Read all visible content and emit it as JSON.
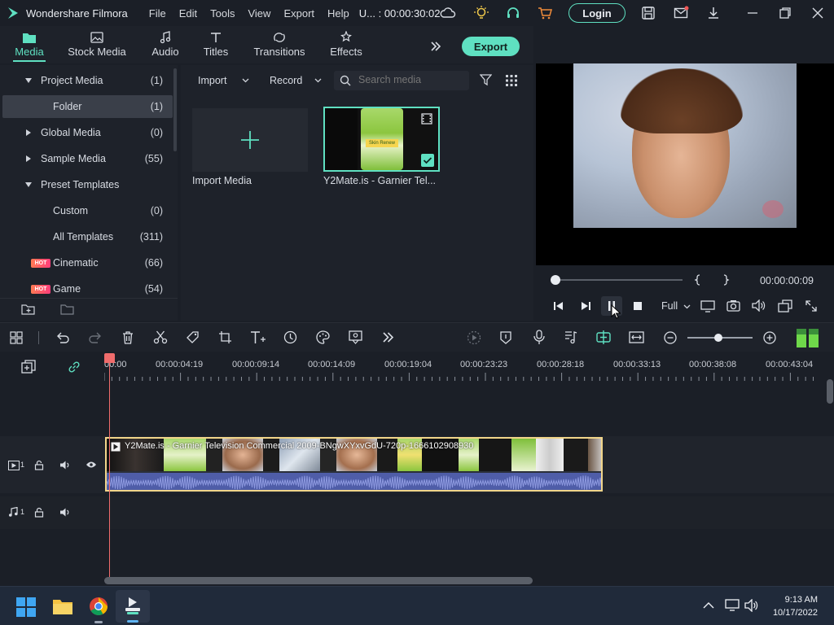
{
  "titlebar": {
    "app_name": "Wondershare Filmora",
    "menu": [
      "File",
      "Edit",
      "Tools",
      "View",
      "Export",
      "Help"
    ],
    "project": "U... : 00:00:30:02",
    "login_label": "Login"
  },
  "media_tabs": [
    {
      "label": "Media",
      "icon": "media-folder-icon",
      "active": true
    },
    {
      "label": "Stock Media",
      "icon": "stock-media-icon"
    },
    {
      "label": "Audio",
      "icon": "music-note-icon"
    },
    {
      "label": "Titles",
      "icon": "text-t-icon"
    },
    {
      "label": "Transitions",
      "icon": "transitions-icon"
    },
    {
      "label": "Effects",
      "icon": "effects-icon"
    }
  ],
  "export_label": "Export",
  "sidebar": {
    "items": [
      {
        "label": "Project Media",
        "count": "(1)",
        "expanded": true
      },
      {
        "label": "Folder",
        "count": "(1)",
        "selected": true
      },
      {
        "label": "Global Media",
        "count": "(0)"
      },
      {
        "label": "Sample Media",
        "count": "(55)"
      },
      {
        "label": "Preset Templates",
        "count": "",
        "expanded": true
      },
      {
        "label": "Custom",
        "count": "(0)"
      },
      {
        "label": "All Templates",
        "count": "(311)"
      },
      {
        "label": "Cinematic",
        "count": "(66)",
        "badge": "HOT"
      },
      {
        "label": "Game",
        "count": "(54)",
        "badge": "HOT"
      }
    ]
  },
  "library": {
    "import_label": "Import",
    "record_label": "Record",
    "search_placeholder": "Search media",
    "import_media_label": "Import Media",
    "clip_label": "Y2Mate.is - Garnier  Tel...",
    "clip_product_text": "Skin Renew"
  },
  "preview": {
    "timecode": "00:00:00:09",
    "quality": "Full",
    "progress": 0.0
  },
  "timeline": {
    "ticks": [
      "00:00",
      "00:00:04:19",
      "00:00:09:14",
      "00:00:14:09",
      "00:00:19:04",
      "00:00:23:23",
      "00:00:28:18",
      "00:00:33:13",
      "00:00:38:08",
      "00:00:43:04"
    ],
    "clip_title": "Y2Mate.is - Garnier  Television Commercial  2009-BNgwXYxvGdU-720p-1666102908930",
    "video_track_num": "1",
    "audio_track_num": "1"
  },
  "taskbar": {
    "time": "9:13 AM",
    "date": "10/17/2022"
  },
  "colors": {
    "accent": "#5fe0c1",
    "clip_border": "#f1d58a",
    "playhead": "#f06c6c",
    "audio_wave": "#4f5da8"
  }
}
